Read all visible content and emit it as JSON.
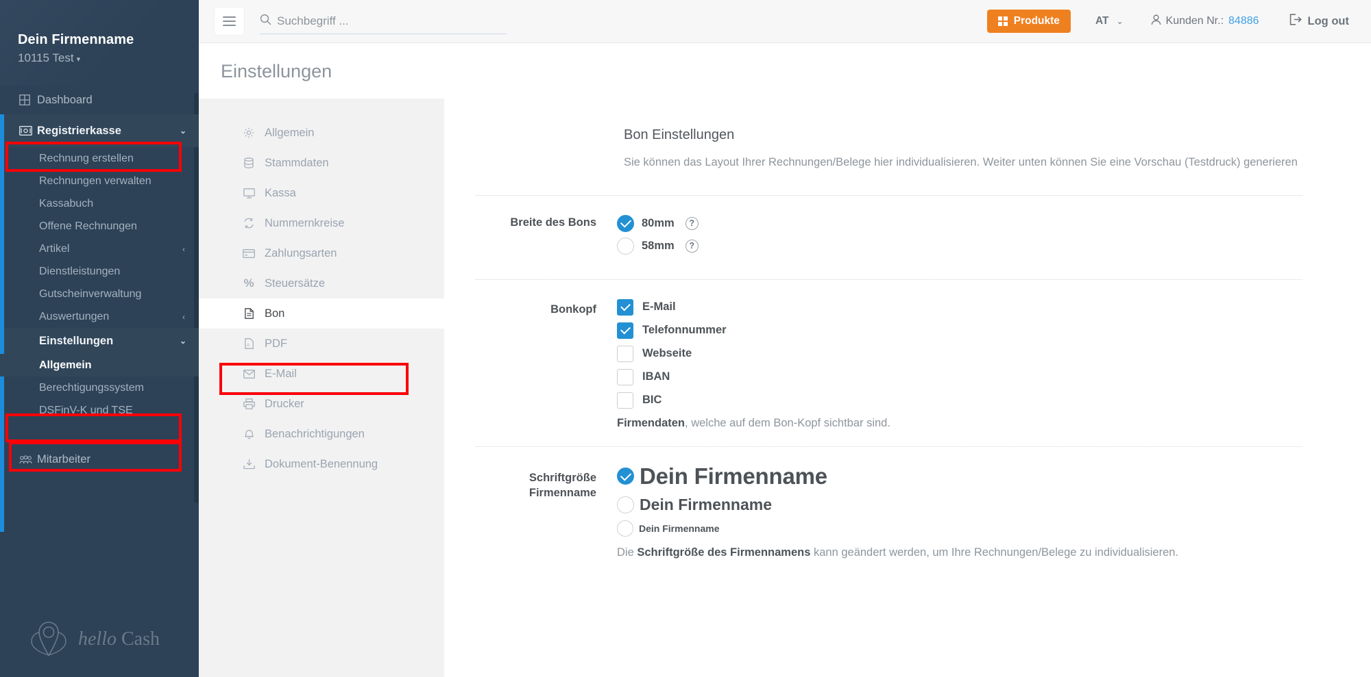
{
  "sidebar": {
    "company": "Dein Firmenname",
    "location": "10115 Test",
    "dashboard": {
      "label": "Dashboard",
      "icon": "grid-icon"
    },
    "groups": [
      {
        "label": "Registrierkasse",
        "icon": "cash-register-icon",
        "expanded": true,
        "highlighted": true,
        "items": [
          {
            "label": "Rechnung erstellen",
            "has_sub": false
          },
          {
            "label": "Rechnungen verwalten",
            "has_sub": false
          },
          {
            "label": "Kassabuch",
            "has_sub": false
          },
          {
            "label": "Offene Rechnungen",
            "has_sub": false
          },
          {
            "label": "Artikel",
            "has_sub": true
          },
          {
            "label": "Dienstleistungen",
            "has_sub": false
          },
          {
            "label": "Gutscheinverwaltung",
            "has_sub": false
          },
          {
            "label": "Auswertungen",
            "has_sub": true
          }
        ]
      },
      {
        "label": "Einstellungen",
        "icon": "settings-icon",
        "expanded": true,
        "highlighted": true,
        "items": [
          {
            "label": "Allgemein",
            "active": true,
            "has_sub": false
          },
          {
            "label": "Berechtigungssystem",
            "has_sub": false
          },
          {
            "label": "DSFinV-K und TSE",
            "has_sub": false
          }
        ]
      }
    ],
    "employees": {
      "label": "Mitarbeiter",
      "icon": "people-icon"
    },
    "logo": {
      "hello": "hello",
      "cash": "Cash"
    }
  },
  "topbar": {
    "menu_toggle": "hamburger-icon",
    "search_placeholder": "Suchbegriff ...",
    "search_value": "",
    "produkte_label": "Produkte",
    "lang": "AT",
    "customer_label": "Kunden Nr.:",
    "customer_number": "84886",
    "logout_label": "Log out"
  },
  "page": {
    "title": "Einstellungen"
  },
  "subnav": {
    "items": [
      {
        "label": "Allgemein",
        "icon": "gear-icon",
        "active": false
      },
      {
        "label": "Stammdaten",
        "icon": "database-icon",
        "active": false
      },
      {
        "label": "Kassa",
        "icon": "monitor-icon",
        "active": false
      },
      {
        "label": "Nummernkreise",
        "icon": "refresh-icon",
        "active": false
      },
      {
        "label": "Zahlungsarten",
        "icon": "credit-card-icon",
        "active": false
      },
      {
        "label": "Steuersätze",
        "icon": "percent-icon",
        "active": false
      },
      {
        "label": "Bon",
        "icon": "document-icon",
        "active": true
      },
      {
        "label": "PDF",
        "icon": "pdf-icon",
        "active": false
      },
      {
        "label": "E-Mail",
        "icon": "envelope-icon",
        "active": false
      },
      {
        "label": "Drucker",
        "icon": "printer-icon",
        "active": false
      },
      {
        "label": "Benachrichtigungen",
        "icon": "bell-icon",
        "active": false
      },
      {
        "label": "Dokument-Benennung",
        "icon": "document-export-icon",
        "active": false
      }
    ]
  },
  "content": {
    "heading": "Bon Einstellungen",
    "description": "Sie können das Layout Ihrer Rechnungen/Belege hier individualisieren. Weiter unten können Sie eine Vorschau (Testdruck) generieren",
    "width_section": {
      "label": "Breite des Bons",
      "options": [
        {
          "label": "80mm",
          "selected": true,
          "help": "?"
        },
        {
          "label": "58mm",
          "selected": false,
          "help": "?"
        }
      ]
    },
    "header_section": {
      "label": "Bonkopf",
      "options": [
        {
          "label": "E-Mail",
          "checked": true
        },
        {
          "label": "Telefonnummer",
          "checked": true
        },
        {
          "label": "Webseite",
          "checked": false
        },
        {
          "label": "IBAN",
          "checked": false
        },
        {
          "label": "BIC",
          "checked": false
        }
      ],
      "note_bold": "Firmendaten",
      "note_rest": ", welche auf dem Bon-Kopf sichtbar sind."
    },
    "fontsize_section": {
      "label_line1": "Schriftgröße",
      "label_line2": "Firmenname",
      "options": [
        {
          "label": "Dein Firmenname",
          "size": "large",
          "selected": true
        },
        {
          "label": "Dein Firmenname",
          "size": "medium",
          "selected": false
        },
        {
          "label": "Dein Firmenname",
          "size": "small",
          "selected": false
        }
      ],
      "note_pre": "Die ",
      "note_bold": "Schriftgröße des Firmennamens",
      "note_rest": " kann geändert werden, um Ihre Rechnungen/Belege zu individualisieren."
    }
  },
  "colors": {
    "sidebar_bg": "#2d4257",
    "accent_blue": "#1b8ddc",
    "control_blue": "#2390d4",
    "orange": "#ef8020",
    "annotation_red": "#fb0007"
  }
}
